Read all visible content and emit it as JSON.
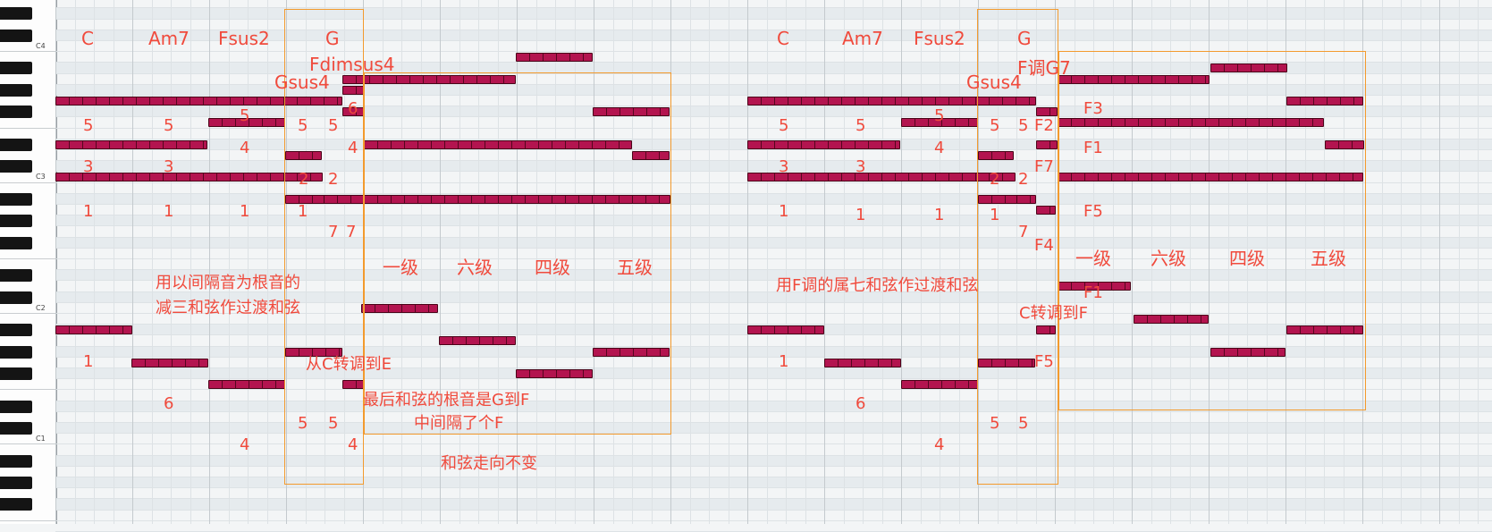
{
  "colors": {
    "note": "#b3144f",
    "annotation": "#f04a3c",
    "highlight_box": "#f39a2d"
  },
  "keyboard": {
    "label_c4": "C4",
    "label_c3": "C3",
    "label_c2": "C2",
    "label_c1": "C1"
  },
  "left": {
    "chords": [
      "C",
      "Am7",
      "Fsus2",
      "G"
    ],
    "extra_chord_1": "Fdimsus4",
    "extra_chord_2": "Gsus4",
    "degrees": [
      "一级",
      "六级",
      "四级",
      "五级"
    ],
    "note_text_1": "用以间隔音为根音的",
    "note_text_2": "减三和弦作过渡和弦",
    "modulation": "从C转调到E",
    "root_text_1": "最后和弦的根音是G到F",
    "root_text_2": "中间隔了个F",
    "direction_text": "和弦走向不变",
    "n5": "5",
    "n4": "4",
    "n3": "3",
    "n2": "2",
    "n1": "1",
    "n6": "6",
    "n7": "7"
  },
  "right": {
    "chords": [
      "C",
      "Am7",
      "Fsus2",
      "G"
    ],
    "extra_chord_1": "F调G7",
    "extra_chord_2": "Gsus4",
    "degrees": [
      "一级",
      "六级",
      "四级",
      "五级"
    ],
    "note_text": "用F调的属七和弦作过渡和弦",
    "modulation": "C转调到F",
    "f_labels": [
      "F3",
      "F2",
      "F1",
      "F7",
      "F5",
      "F4",
      "F1",
      "F5"
    ]
  }
}
